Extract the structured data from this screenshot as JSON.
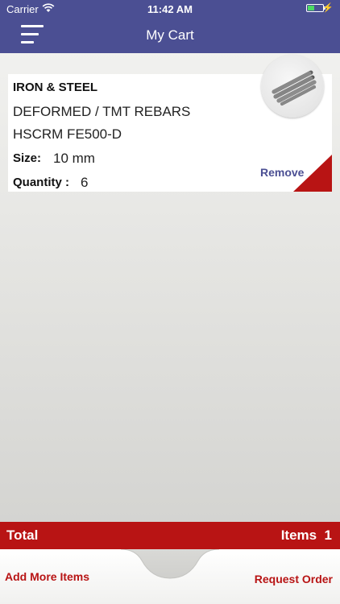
{
  "status_bar": {
    "carrier": "Carrier",
    "time": "11:42 AM",
    "battery_level": 0.45
  },
  "header": {
    "title": "My Cart",
    "menu_icon": "hamburger-icon"
  },
  "cart": {
    "items": [
      {
        "category": "IRON & STEEL",
        "product_line1": "DEFORMED / TMT REBARS",
        "product_line2": "HSCRM FE500-D",
        "size_label": "Size:",
        "size_value": "10 mm",
        "quantity_label": "Quantity :",
        "quantity_value": "6",
        "remove_label": "Remove",
        "thumbnail": "rebar-image"
      }
    ]
  },
  "footer": {
    "total_label": "Total",
    "items_count": "Items  1",
    "add_more_label": "Add More Items",
    "request_order_label": "Request Order"
  },
  "colors": {
    "header": "#4b4f93",
    "accent_red": "#b81414",
    "remove_text": "#4b4f93"
  }
}
